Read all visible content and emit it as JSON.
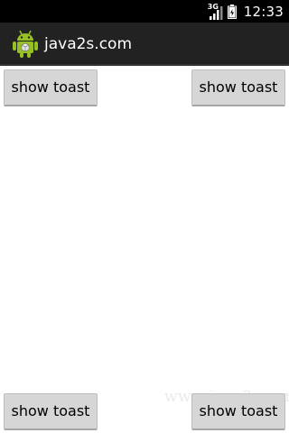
{
  "status_bar": {
    "network_type": "3G",
    "time": "12:33"
  },
  "action_bar": {
    "title": "java2s.com",
    "icon": "android-robot-icon",
    "background": "#222222"
  },
  "buttons": {
    "top_left": "show toast",
    "top_right": "show toast",
    "bottom_left": "show toast",
    "bottom_right": "show toast"
  },
  "watermark": "www.java2s.com",
  "colors": {
    "android_green": "#97c024",
    "button_bg": "#d6d6d6"
  }
}
